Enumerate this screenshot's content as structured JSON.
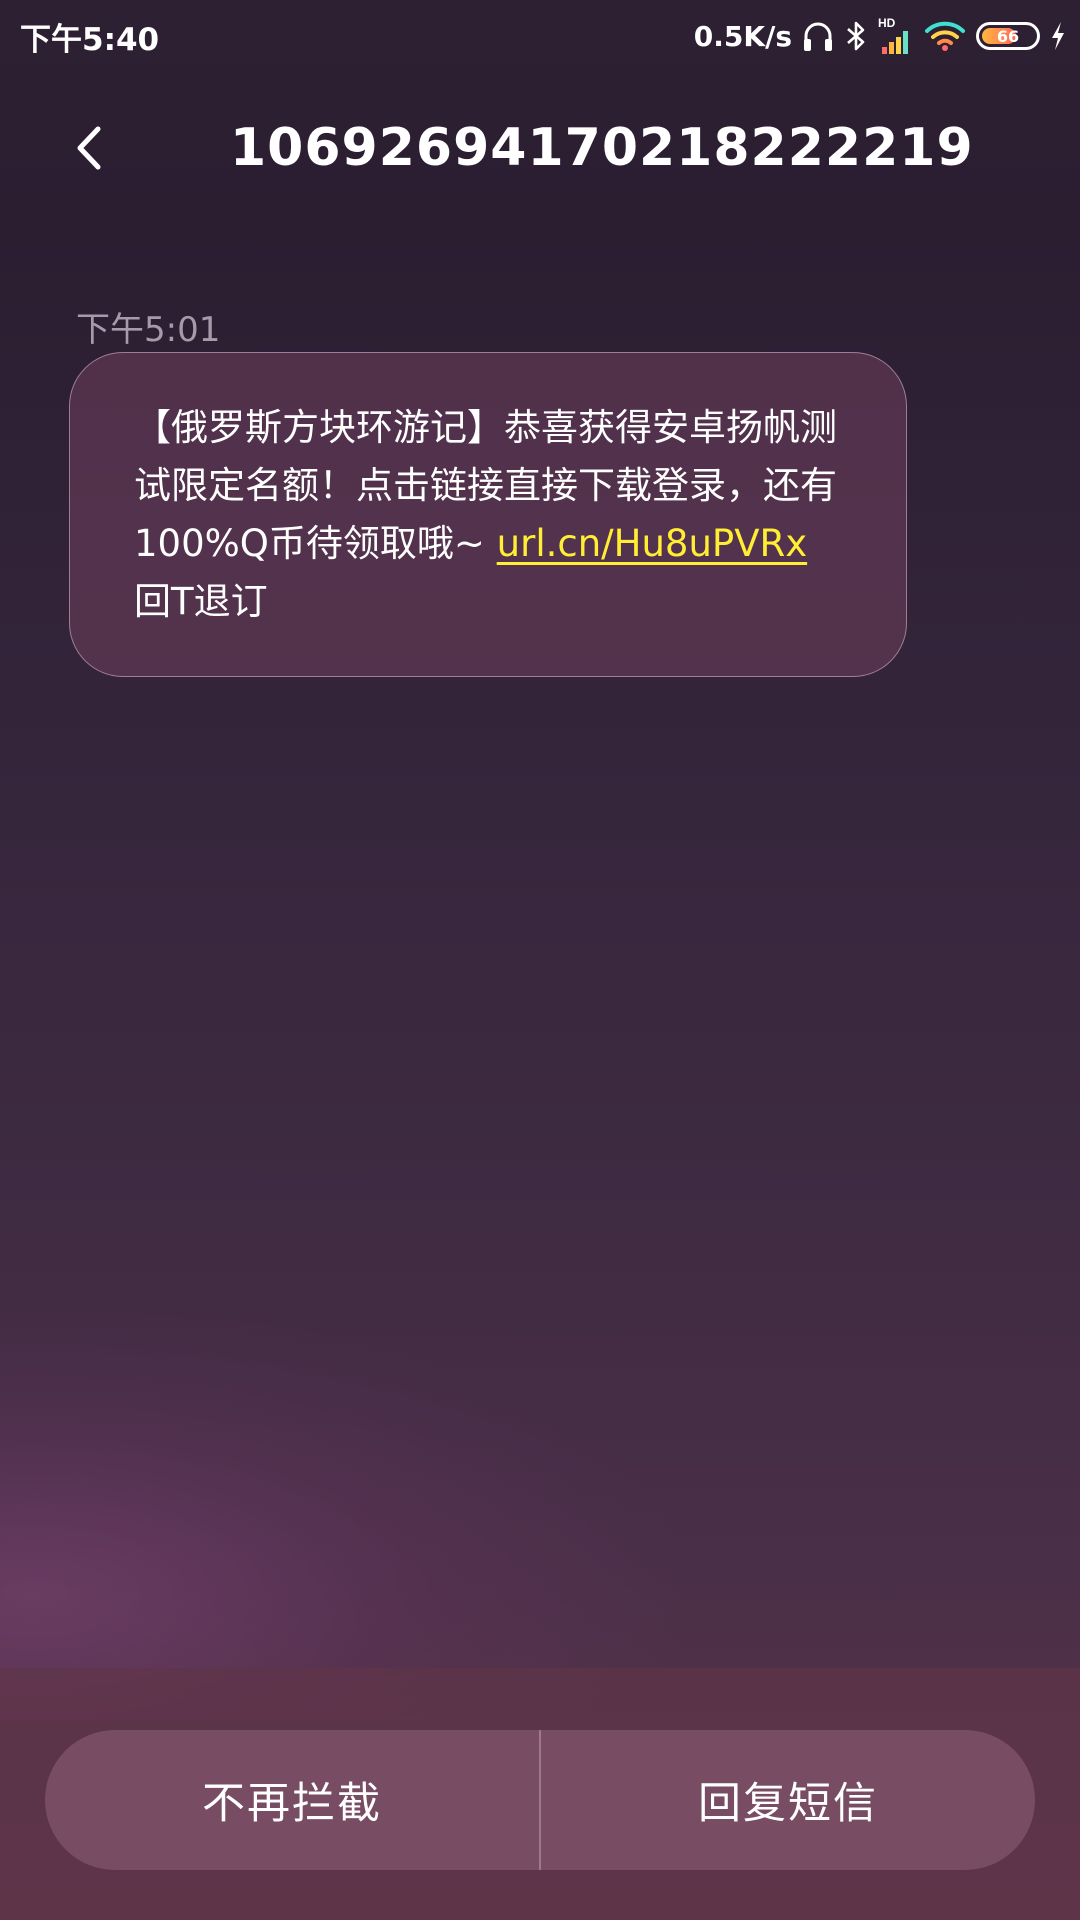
{
  "status_bar": {
    "time": "下午5:40",
    "net_speed": "0.5K/s",
    "network_badge": "HD",
    "battery_level": "66",
    "battery_fraction": 0.66,
    "icons": [
      "headphones-icon",
      "bluetooth-icon",
      "cell-signal-icon",
      "wifi-icon",
      "battery-icon",
      "charging-icon"
    ]
  },
  "header": {
    "back_icon": "chevron-left-icon",
    "title": "1069269417021822221​9"
  },
  "messages": [
    {
      "time": "下午5:01",
      "text_before_link": "【俄罗斯方块环游记】恭喜获得安卓扬帆测试限定名额！点击链接直接下载登录，还有100%Q币待领取哦~ ",
      "link": "url.cn/Hu8uPVRx",
      "text_after_link": " 回T退订"
    }
  ],
  "actions": {
    "stop_blocking": "不再拦截",
    "reply_sms": "回复短信"
  },
  "colors": {
    "link": "#ffee33",
    "timestamp": "#a89aab"
  }
}
